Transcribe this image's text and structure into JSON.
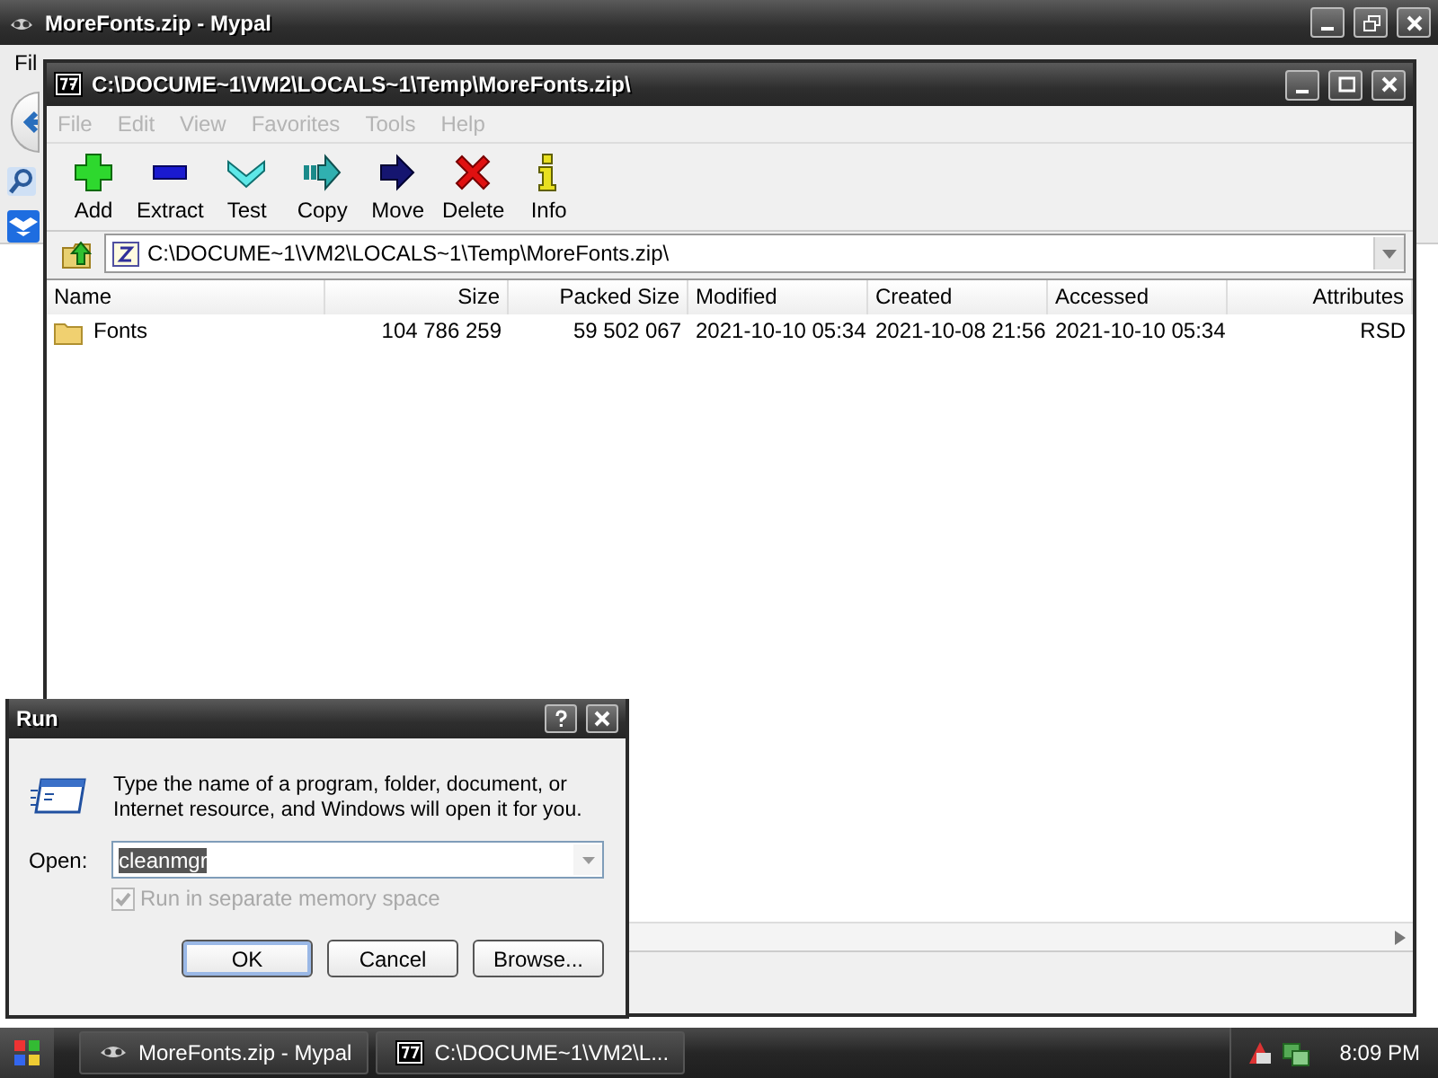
{
  "browser_window": {
    "title": "MoreFonts.zip - Mypal",
    "menu": [
      "Fil"
    ]
  },
  "archive_window": {
    "title": "C:\\DOCUME~1\\VM2\\LOCALS~1\\Temp\\MoreFonts.zip\\",
    "menu": [
      {
        "label": "File",
        "disabled": true
      },
      {
        "label": "Edit",
        "disabled": true
      },
      {
        "label": "View",
        "disabled": true
      },
      {
        "label": "Favorites",
        "disabled": true
      },
      {
        "label": "Tools",
        "disabled": true
      },
      {
        "label": "Help",
        "disabled": true
      }
    ],
    "toolbar": [
      {
        "kind": "add",
        "label": "Add"
      },
      {
        "kind": "extract",
        "label": "Extract"
      },
      {
        "kind": "test",
        "label": "Test"
      },
      {
        "kind": "copy",
        "label": "Copy"
      },
      {
        "kind": "move",
        "label": "Move"
      },
      {
        "kind": "delete",
        "label": "Delete"
      },
      {
        "kind": "info",
        "label": "Info"
      }
    ],
    "address": "C:\\DOCUME~1\\VM2\\LOCALS~1\\Temp\\MoreFonts.zip\\",
    "columns": [
      "Name",
      "Size",
      "Packed Size",
      "Modified",
      "Created",
      "Accessed",
      "Attributes"
    ],
    "rows": [
      {
        "kind": "folder",
        "cells": [
          "Fonts",
          "104 786 259",
          "59 502 067",
          "2021-10-10 05:34",
          "2021-10-08 21:56",
          "2021-10-10 05:34",
          "RSD"
        ]
      }
    ]
  },
  "run_dialog": {
    "title": "Run",
    "prompt": "Type the name of a program, folder, document, or Internet resource, and Windows will open it for you.",
    "open_label": "Open:",
    "value": "cleanmgr",
    "value_selected": true,
    "checkbox": {
      "label": "Run in separate memory space",
      "checked": true,
      "disabled": true
    },
    "buttons": [
      {
        "label": "OK",
        "default": true
      },
      {
        "label": "Cancel",
        "default": false
      },
      {
        "label": "Browse...",
        "default": false
      }
    ]
  },
  "taskbar": {
    "tasks": [
      {
        "kind": "browser",
        "label": "MoreFonts.zip - Mypal",
        "selected": false
      },
      {
        "kind": "archive",
        "label": "C:\\DOCUME~1\\VM2\\L...",
        "selected": false
      }
    ],
    "clock": "8:09 PM"
  }
}
